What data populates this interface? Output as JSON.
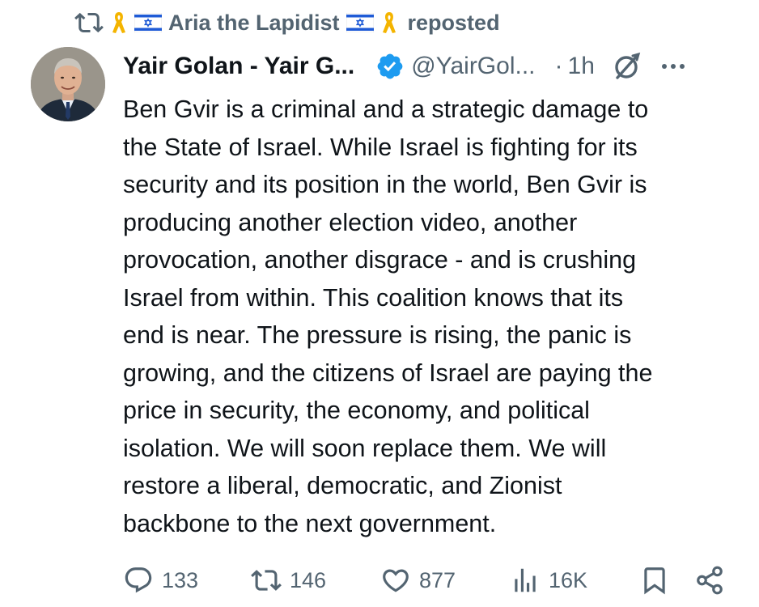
{
  "repost_context": {
    "reposter_name": "Aria the Lapidist",
    "label": "reposted"
  },
  "post": {
    "author": {
      "display_name": "Yair Golan - Yair G...",
      "handle": "@YairGol...",
      "verified": true
    },
    "separator": "·",
    "time": "1h",
    "text": "Ben Gvir is a criminal and a strategic damage to\nthe State of Israel. While Israel is fighting for its\nsecurity and its position in the world, Ben Gvir is\nproducing another election video, another\nprovocation, another disgrace - and is crushing\nIsrael from within. This coalition knows that its\nend is near. The pressure is rising, the panic is\ngrowing, and the citizens of Israel are paying the\nprice in security, the economy, and political\nisolation. We will soon replace them. We will\nrestore a liberal, democratic, and Zionist\nbackbone to the next government."
  },
  "actions": {
    "replies": "133",
    "reposts": "146",
    "likes": "877",
    "views": "16K"
  },
  "icons": {
    "repost_context": "repost-icon",
    "ribbon": "yellow-ribbon-icon",
    "flag": "israel-flag-icon",
    "verified": "verified-badge-icon",
    "grok": "grok-icon",
    "more": "more-icon",
    "reply": "reply-icon",
    "repost": "repost-icon",
    "like": "heart-icon",
    "views": "views-icon",
    "bookmark": "bookmark-icon",
    "share": "share-icon"
  },
  "colors": {
    "text_primary": "#0f1419",
    "text_secondary": "#536471",
    "verified_blue": "#1d9bf0",
    "ribbon_yellow": "#f4b400",
    "flag_blue": "#1f5bd6"
  }
}
